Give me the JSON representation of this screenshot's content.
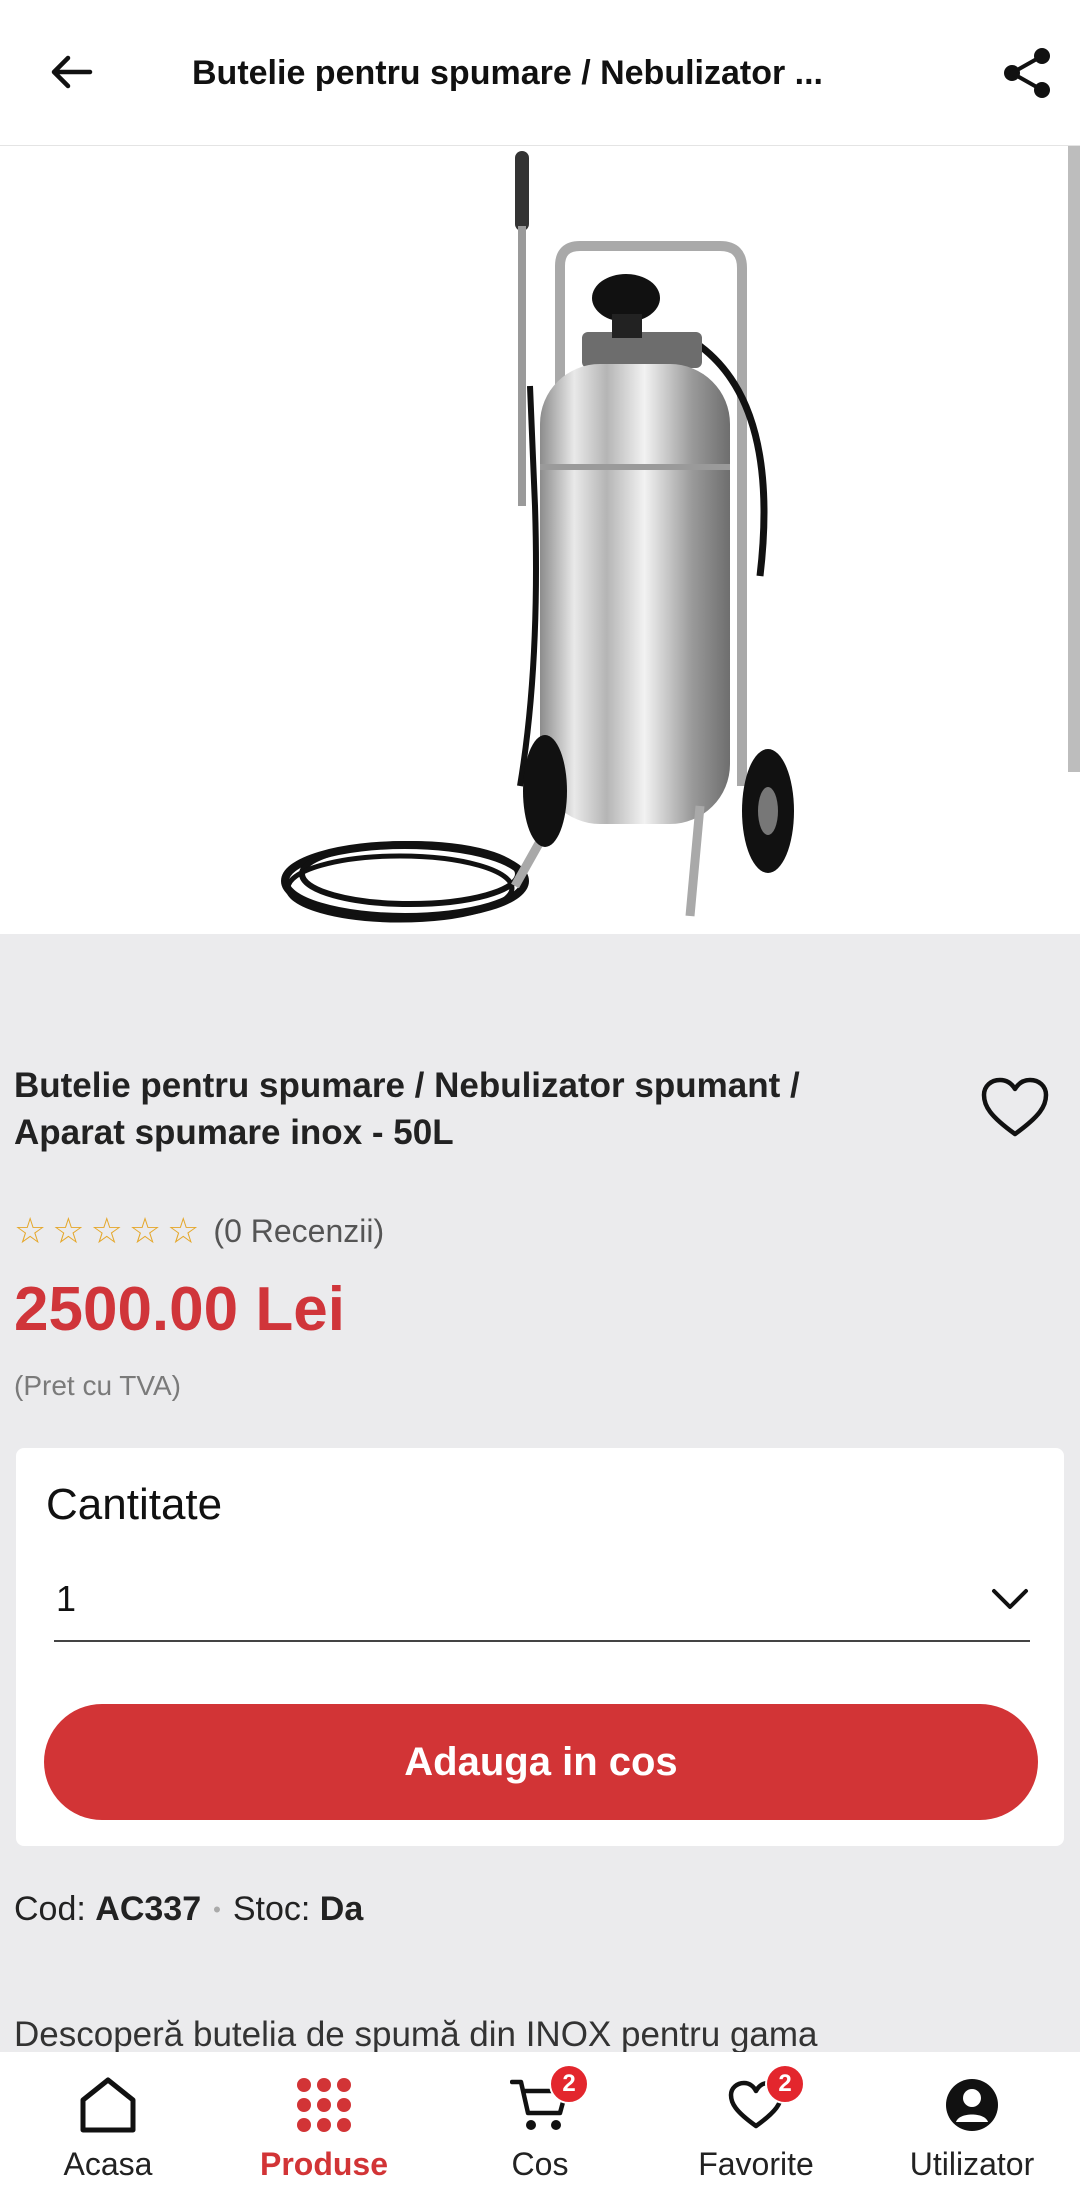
{
  "header": {
    "title": "Butelie pentru spumare / Nebulizator ..."
  },
  "product": {
    "title": "Butelie pentru spumare / Nebulizator spumant / Aparat spumare inox - 50L",
    "rating": {
      "stars": 0,
      "max_stars": 5,
      "reviews_label": "(0 Recenzii)"
    },
    "price": "2500.00 Lei",
    "vat_note": "(Pret cu TVA)",
    "code_label": "Cod:",
    "code_value": "AC337",
    "stock_label": "Stoc:",
    "stock_value": "Da",
    "description_preview": "Descoperă butelia de spumă din INOX pentru gama"
  },
  "quantity": {
    "label": "Cantitate",
    "selected": "1",
    "add_to_cart": "Adauga in cos"
  },
  "nav": {
    "items": [
      {
        "label": "Acasa",
        "icon": "home-icon",
        "active": false
      },
      {
        "label": "Produse",
        "icon": "grid-icon",
        "active": true
      },
      {
        "label": "Cos",
        "icon": "cart-icon",
        "active": false,
        "badge": "2"
      },
      {
        "label": "Favorite",
        "icon": "heart-icon",
        "active": false,
        "badge": "2"
      },
      {
        "label": "Utilizator",
        "icon": "user-icon",
        "active": false
      }
    ]
  },
  "colors": {
    "accent": "#d23436",
    "price": "#d0353a",
    "star": "#e5a72a",
    "background": "#ebebed"
  }
}
